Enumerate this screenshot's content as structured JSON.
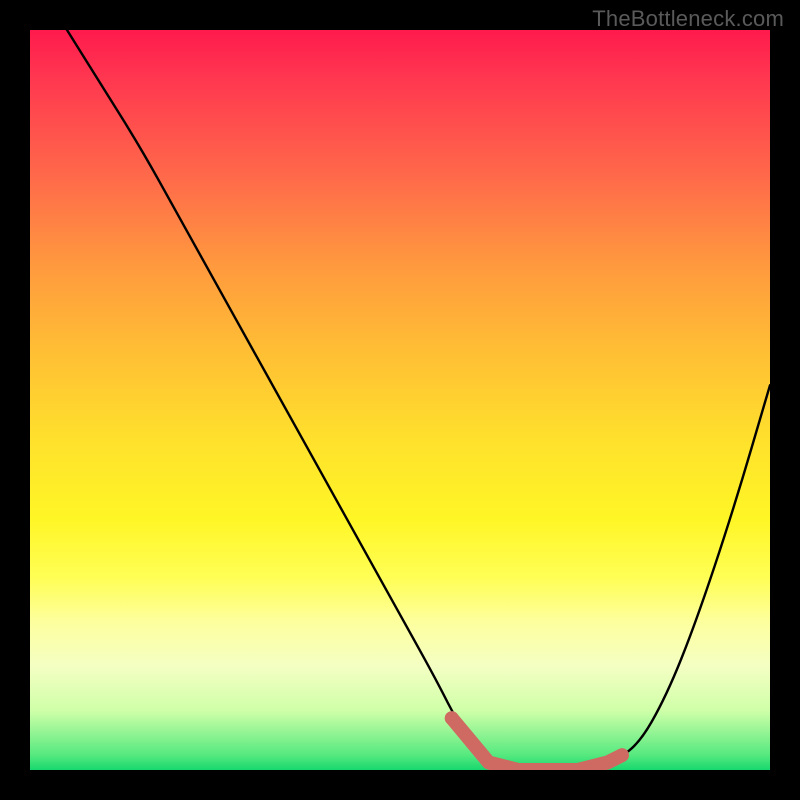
{
  "attribution": "TheBottleneck.com",
  "chart_data": {
    "type": "line",
    "title": "",
    "xlabel": "",
    "ylabel": "",
    "xlim": [
      0,
      100
    ],
    "ylim": [
      0,
      100
    ],
    "grid": false,
    "legend": false,
    "series": [
      {
        "name": "bottleneck-curve",
        "x": [
          5,
          10,
          15,
          20,
          25,
          30,
          35,
          40,
          45,
          50,
          55,
          58,
          62,
          66,
          70,
          74,
          78,
          82,
          86,
          90,
          95,
          100
        ],
        "y": [
          100,
          92,
          84,
          75,
          66,
          57,
          48,
          39,
          30,
          21,
          12,
          6,
          1,
          0,
          0,
          0,
          1,
          3,
          10,
          20,
          35,
          52
        ]
      }
    ],
    "highlight": {
      "name": "optimal-range",
      "color": "#cf6a63",
      "points": [
        {
          "x": 57,
          "y": 7
        },
        {
          "x": 62,
          "y": 1
        },
        {
          "x": 66,
          "y": 0
        },
        {
          "x": 70,
          "y": 0
        },
        {
          "x": 74,
          "y": 0
        },
        {
          "x": 78,
          "y": 1
        },
        {
          "x": 80,
          "y": 2
        }
      ]
    },
    "gradient": {
      "top_color": "#ff1a4d",
      "mid_color": "#ffe22c",
      "bottom_color": "#17d86e"
    }
  }
}
